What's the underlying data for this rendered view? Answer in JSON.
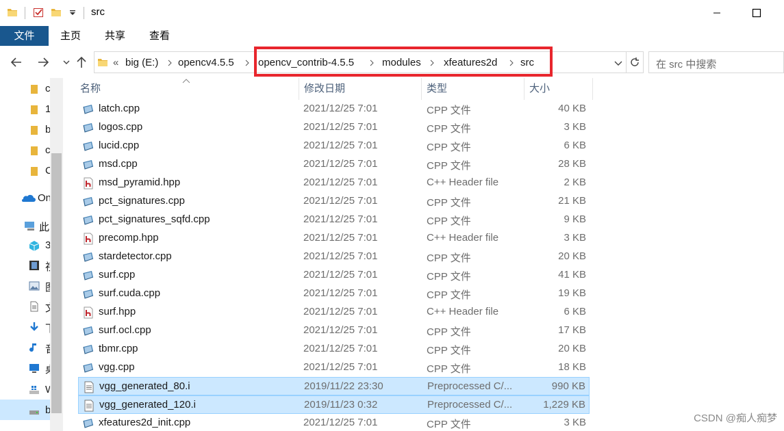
{
  "window": {
    "title": "src",
    "minimize_icon": "minimize-icon",
    "maximize_icon": "maximize-icon"
  },
  "ribbon": {
    "tabs": [
      "文件",
      "主页",
      "共享",
      "查看"
    ]
  },
  "address": {
    "overflow": "«",
    "crumbs": [
      "big (E:)",
      "opencv4.5.5",
      "opencv_contrib-4.5.5",
      "modules",
      "xfeatures2d",
      "src"
    ],
    "search_placeholder": "在 src 中搜索",
    "highlight_color": "#e8262d"
  },
  "sidebar": {
    "items": [
      {
        "label": "c",
        "icon": "folder-icon"
      },
      {
        "label": "1",
        "icon": "folder-icon"
      },
      {
        "label": "b",
        "icon": "folder-icon"
      },
      {
        "label": "c",
        "icon": "folder-icon"
      },
      {
        "label": "C",
        "icon": "folder-icon"
      },
      {
        "label": "On",
        "icon": "onedrive-icon"
      },
      {
        "label": "此",
        "icon": "this-pc-icon"
      },
      {
        "label": "3",
        "icon": "3d-objects-icon"
      },
      {
        "label": "视",
        "icon": "videos-icon"
      },
      {
        "label": "图",
        "icon": "pictures-icon"
      },
      {
        "label": "文",
        "icon": "documents-icon"
      },
      {
        "label": "下",
        "icon": "downloads-icon"
      },
      {
        "label": "音",
        "icon": "music-icon"
      },
      {
        "label": "桌",
        "icon": "desktop-icon"
      },
      {
        "label": "W",
        "icon": "windows-drive-icon"
      },
      {
        "label": "b",
        "icon": "drive-icon"
      }
    ]
  },
  "columns": {
    "name": "名称",
    "date": "修改日期",
    "type": "类型",
    "size": "大小"
  },
  "files": [
    {
      "name": "latch.cpp",
      "date": "2021/12/25 7:01",
      "type": "CPP 文件",
      "size": "40 KB",
      "kind": "cpp"
    },
    {
      "name": "logos.cpp",
      "date": "2021/12/25 7:01",
      "type": "CPP 文件",
      "size": "3 KB",
      "kind": "cpp"
    },
    {
      "name": "lucid.cpp",
      "date": "2021/12/25 7:01",
      "type": "CPP 文件",
      "size": "6 KB",
      "kind": "cpp"
    },
    {
      "name": "msd.cpp",
      "date": "2021/12/25 7:01",
      "type": "CPP 文件",
      "size": "28 KB",
      "kind": "cpp"
    },
    {
      "name": "msd_pyramid.hpp",
      "date": "2021/12/25 7:01",
      "type": "C++ Header file",
      "size": "2 KB",
      "kind": "hpp"
    },
    {
      "name": "pct_signatures.cpp",
      "date": "2021/12/25 7:01",
      "type": "CPP 文件",
      "size": "21 KB",
      "kind": "cpp"
    },
    {
      "name": "pct_signatures_sqfd.cpp",
      "date": "2021/12/25 7:01",
      "type": "CPP 文件",
      "size": "9 KB",
      "kind": "cpp"
    },
    {
      "name": "precomp.hpp",
      "date": "2021/12/25 7:01",
      "type": "C++ Header file",
      "size": "3 KB",
      "kind": "hpp"
    },
    {
      "name": "stardetector.cpp",
      "date": "2021/12/25 7:01",
      "type": "CPP 文件",
      "size": "20 KB",
      "kind": "cpp"
    },
    {
      "name": "surf.cpp",
      "date": "2021/12/25 7:01",
      "type": "CPP 文件",
      "size": "41 KB",
      "kind": "cpp"
    },
    {
      "name": "surf.cuda.cpp",
      "date": "2021/12/25 7:01",
      "type": "CPP 文件",
      "size": "19 KB",
      "kind": "cpp"
    },
    {
      "name": "surf.hpp",
      "date": "2021/12/25 7:01",
      "type": "C++ Header file",
      "size": "6 KB",
      "kind": "hpp"
    },
    {
      "name": "surf.ocl.cpp",
      "date": "2021/12/25 7:01",
      "type": "CPP 文件",
      "size": "17 KB",
      "kind": "cpp"
    },
    {
      "name": "tbmr.cpp",
      "date": "2021/12/25 7:01",
      "type": "CPP 文件",
      "size": "20 KB",
      "kind": "cpp"
    },
    {
      "name": "vgg.cpp",
      "date": "2021/12/25 7:01",
      "type": "CPP 文件",
      "size": "18 KB",
      "kind": "cpp"
    },
    {
      "name": "vgg_generated_80.i",
      "date": "2019/11/22 23:30",
      "type": "Preprocessed C/...",
      "size": "990 KB",
      "kind": "i",
      "selected": true
    },
    {
      "name": "vgg_generated_120.i",
      "date": "2019/11/23 0:32",
      "type": "Preprocessed C/...",
      "size": "1,229 KB",
      "kind": "i",
      "selected": true
    },
    {
      "name": "xfeatures2d_init.cpp",
      "date": "2021/12/25 7:01",
      "type": "CPP 文件",
      "size": "3 KB",
      "kind": "cpp"
    }
  ],
  "watermark": "CSDN @痴人痴梦",
  "colors": {
    "file_tab": "#19578e",
    "selection": "#cce8ff",
    "selection_border": "#99d1ff"
  }
}
